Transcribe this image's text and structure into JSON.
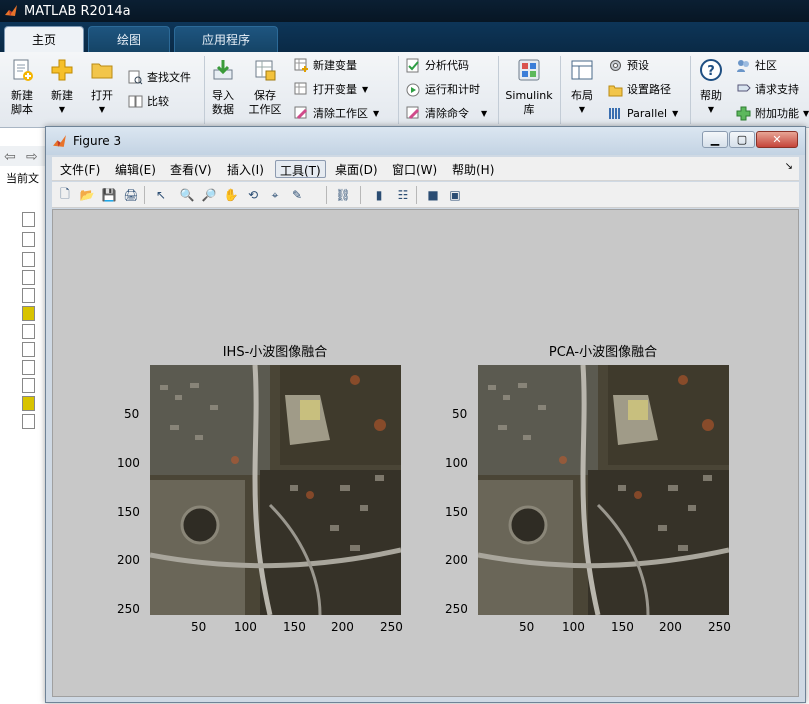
{
  "app": {
    "title": "MATLAB R2014a"
  },
  "ribbon_tabs": [
    {
      "label": "主页",
      "active": true
    },
    {
      "label": "绘图",
      "active": false
    },
    {
      "label": "应用程序",
      "active": false
    }
  ],
  "ribbon": {
    "new_script": "新建\n脚本",
    "new": "新建",
    "open": "打开",
    "find_files": "查找文件",
    "compare": "比较",
    "import_data": "导入\n数据",
    "save_workspace": "保存\n工作区",
    "new_variable": "新建变量",
    "open_variable": "打开变量",
    "clear_workspace": "清除工作区",
    "analyze_code": "分析代码",
    "run_and_time": "运行和计时",
    "clear_commands": "清除命令",
    "simulink": "Simulink\n库",
    "layout": "布局",
    "preferences": "预设",
    "set_path": "设置路径",
    "parallel": "Parallel",
    "help": "帮助",
    "community": "社区",
    "request_support": "请求支持",
    "add_ons": "附加功能"
  },
  "left_pane": {
    "current_folder_label": "当前文"
  },
  "figure": {
    "title": "Figure 3",
    "menu": [
      {
        "label": "文件(F)"
      },
      {
        "label": "编辑(E)"
      },
      {
        "label": "查看(V)"
      },
      {
        "label": "插入(I)"
      },
      {
        "label": "工具(T)",
        "selected": true
      },
      {
        "label": "桌面(D)"
      },
      {
        "label": "窗口(W)"
      },
      {
        "label": "帮助(H)"
      }
    ],
    "toolbar_icons": [
      "new-figure-icon",
      "open-file-icon",
      "save-icon",
      "print-icon",
      "select-arrow-icon",
      "zoom-in-icon",
      "zoom-out-icon",
      "pan-hand-icon",
      "rotate-3d-icon",
      "data-cursor-icon",
      "brush-icon",
      "link-plot-icon",
      "colorbar-icon",
      "legend-icon",
      "hide-plot-tools-icon",
      "show-plot-tools-icon"
    ],
    "axes": [
      {
        "title": "IHS-小波图像融合",
        "yticks": [
          "50",
          "100",
          "150",
          "200",
          "250"
        ],
        "xticks": [
          "50",
          "100",
          "150",
          "200",
          "250"
        ]
      },
      {
        "title": "PCA-小波图像融合",
        "yticks": [
          "50",
          "100",
          "150",
          "200",
          "250"
        ],
        "xticks": [
          "50",
          "100",
          "150",
          "200",
          "250"
        ]
      }
    ]
  }
}
